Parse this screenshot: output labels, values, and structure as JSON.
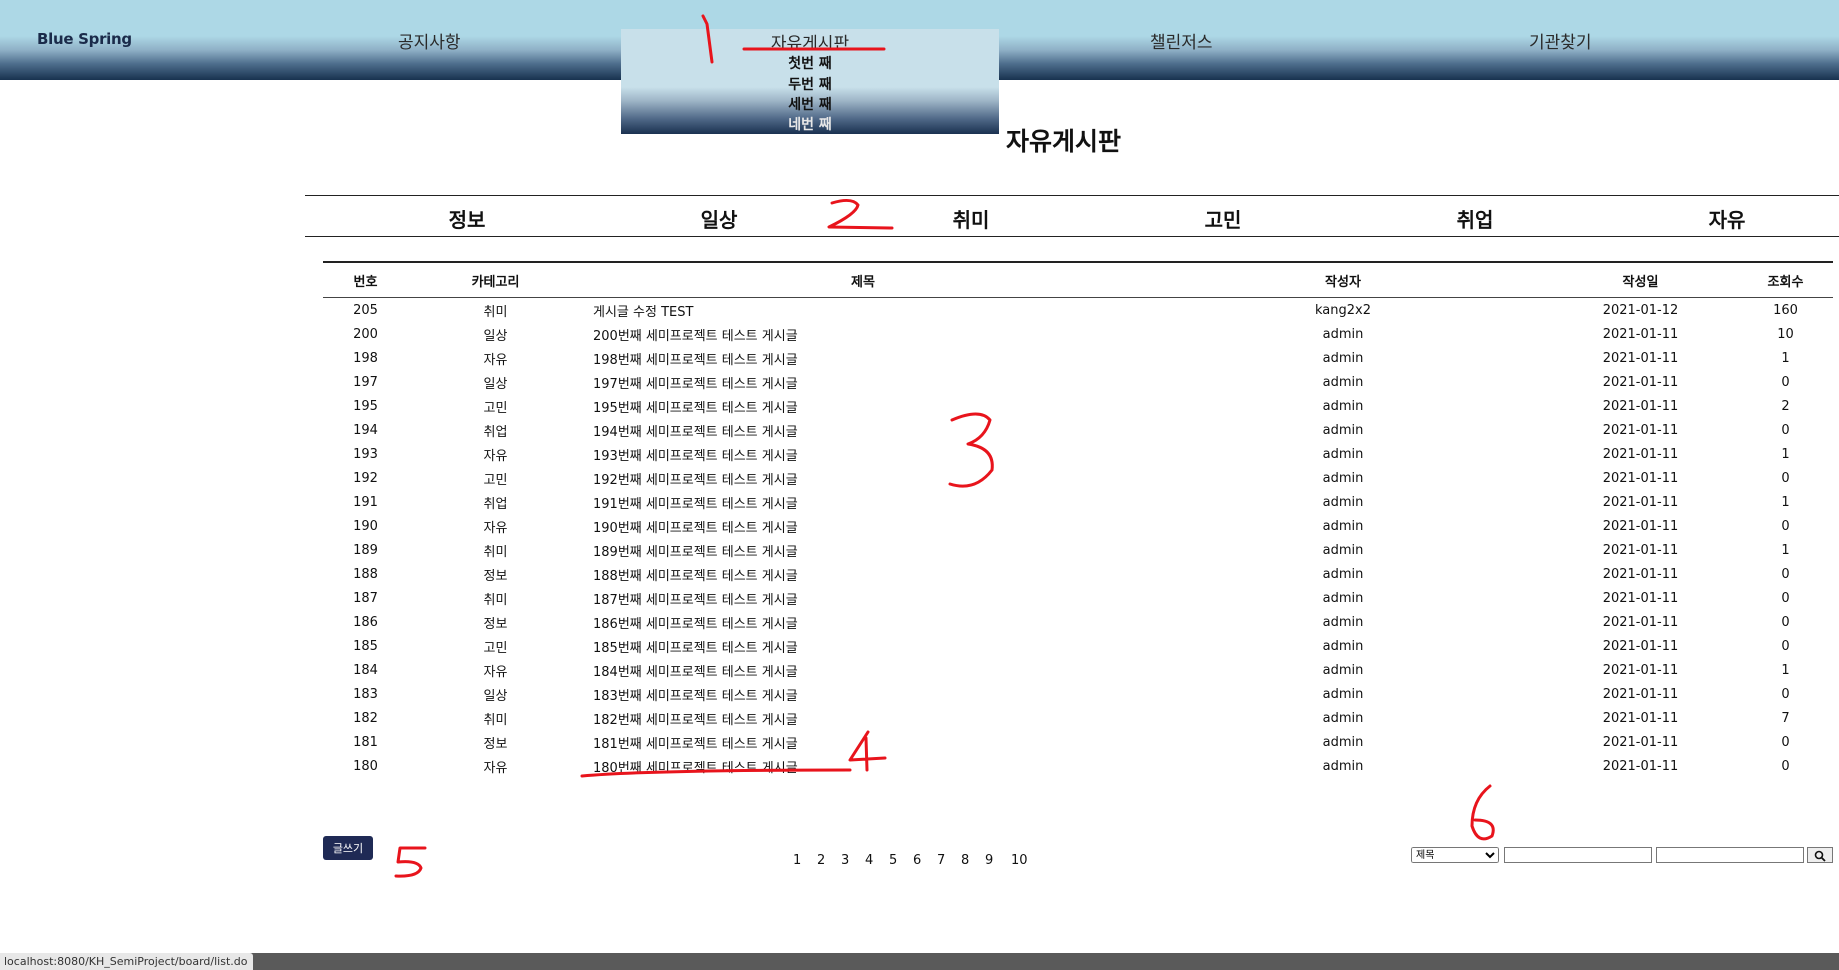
{
  "header": {
    "logo": "Blue Spring",
    "nav": [
      "공지사항",
      "자유게시판",
      "챌린저스",
      "기관찾기"
    ]
  },
  "dropdown": {
    "items": [
      "첫번 째",
      "두번 째",
      "세번 째",
      "네번 째"
    ]
  },
  "board": {
    "title": "자유게시판",
    "categories": [
      "정보",
      "일상",
      "취미",
      "고민",
      "취업",
      "자유"
    ],
    "columns": [
      "번호",
      "카테고리",
      "제목",
      "작성자",
      "작성일",
      "조회수"
    ],
    "rows": [
      {
        "num": "205",
        "cat": "취미",
        "title": "게시글 수정 TEST",
        "writer": "kang2x2",
        "date": "2021-01-12",
        "views": "160"
      },
      {
        "num": "200",
        "cat": "일상",
        "title": "200번째 세미프로젝트 테스트 게시글",
        "writer": "admin",
        "date": "2021-01-11",
        "views": "10"
      },
      {
        "num": "198",
        "cat": "자유",
        "title": "198번째 세미프로젝트 테스트 게시글",
        "writer": "admin",
        "date": "2021-01-11",
        "views": "1"
      },
      {
        "num": "197",
        "cat": "일상",
        "title": "197번째 세미프로젝트 테스트 게시글",
        "writer": "admin",
        "date": "2021-01-11",
        "views": "0"
      },
      {
        "num": "195",
        "cat": "고민",
        "title": "195번째 세미프로젝트 테스트 게시글",
        "writer": "admin",
        "date": "2021-01-11",
        "views": "2"
      },
      {
        "num": "194",
        "cat": "취업",
        "title": "194번째 세미프로젝트 테스트 게시글",
        "writer": "admin",
        "date": "2021-01-11",
        "views": "0"
      },
      {
        "num": "193",
        "cat": "자유",
        "title": "193번째 세미프로젝트 테스트 게시글",
        "writer": "admin",
        "date": "2021-01-11",
        "views": "1"
      },
      {
        "num": "192",
        "cat": "고민",
        "title": "192번째 세미프로젝트 테스트 게시글",
        "writer": "admin",
        "date": "2021-01-11",
        "views": "0"
      },
      {
        "num": "191",
        "cat": "취업",
        "title": "191번째 세미프로젝트 테스트 게시글",
        "writer": "admin",
        "date": "2021-01-11",
        "views": "1"
      },
      {
        "num": "190",
        "cat": "자유",
        "title": "190번째 세미프로젝트 테스트 게시글",
        "writer": "admin",
        "date": "2021-01-11",
        "views": "0"
      },
      {
        "num": "189",
        "cat": "취미",
        "title": "189번째 세미프로젝트 테스트 게시글",
        "writer": "admin",
        "date": "2021-01-11",
        "views": "1"
      },
      {
        "num": "188",
        "cat": "정보",
        "title": "188번째 세미프로젝트 테스트 게시글",
        "writer": "admin",
        "date": "2021-01-11",
        "views": "0"
      },
      {
        "num": "187",
        "cat": "취미",
        "title": "187번째 세미프로젝트 테스트 게시글",
        "writer": "admin",
        "date": "2021-01-11",
        "views": "0"
      },
      {
        "num": "186",
        "cat": "정보",
        "title": "186번째 세미프로젝트 테스트 게시글",
        "writer": "admin",
        "date": "2021-01-11",
        "views": "0"
      },
      {
        "num": "185",
        "cat": "고민",
        "title": "185번째 세미프로젝트 테스트 게시글",
        "writer": "admin",
        "date": "2021-01-11",
        "views": "0"
      },
      {
        "num": "184",
        "cat": "자유",
        "title": "184번째 세미프로젝트 테스트 게시글",
        "writer": "admin",
        "date": "2021-01-11",
        "views": "1"
      },
      {
        "num": "183",
        "cat": "일상",
        "title": "183번째 세미프로젝트 테스트 게시글",
        "writer": "admin",
        "date": "2021-01-11",
        "views": "0"
      },
      {
        "num": "182",
        "cat": "취미",
        "title": "182번째 세미프로젝트 테스트 게시글",
        "writer": "admin",
        "date": "2021-01-11",
        "views": "7"
      },
      {
        "num": "181",
        "cat": "정보",
        "title": "181번째 세미프로젝트 테스트 게시글",
        "writer": "admin",
        "date": "2021-01-11",
        "views": "0"
      },
      {
        "num": "180",
        "cat": "자유",
        "title": "180번째 세미프로젝트 테스트 게시글",
        "writer": "admin",
        "date": "2021-01-11",
        "views": "0"
      }
    ]
  },
  "write_button": "글쓰기",
  "pagination": [
    "1",
    "2",
    "3",
    "4",
    "5",
    "6",
    "7",
    "8",
    "9",
    "10"
  ],
  "search": {
    "selected_option": "제목",
    "button_icon": "search-icon"
  },
  "status_url": "localhost:8080/KH_SemiProject/board/list.do",
  "annotations": [
    "1",
    "2",
    "3",
    "4",
    "5",
    "6"
  ],
  "annotation_color": "#e8141c"
}
